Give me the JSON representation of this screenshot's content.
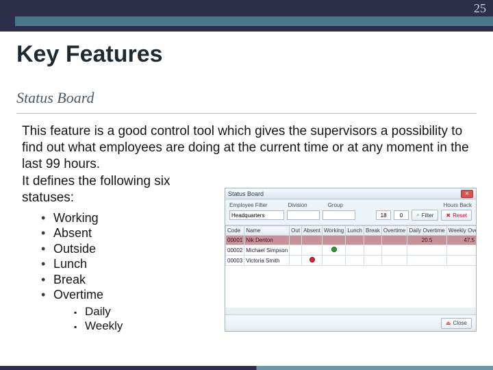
{
  "page_number": "25",
  "heading": "Key Features",
  "subheading": "Status Board",
  "paragraph1": "This feature is a good control tool which gives the supervisors a possibility to find out what employees are doing at the current time or at any moment in the last 99 hours.",
  "paragraph2": "It defines the following six statuses:",
  "statuses": [
    "Working",
    "Absent",
    "Outside",
    "Lunch",
    "Break",
    "Overtime"
  ],
  "overtime_sub": [
    "Daily",
    "Weekly"
  ],
  "shot": {
    "title": "Status Board",
    "filter_labels": {
      "employee": "Employee Filter",
      "division": "Division",
      "group": "Group",
      "hours_back": "Hours Back"
    },
    "filter_values": {
      "employee": "Headquarters",
      "division": "",
      "group": "",
      "hours_back_from": "18",
      "hours_back_to": "0"
    },
    "buttons": {
      "filter": "Filter",
      "reset": "Reset",
      "close": "Close"
    },
    "columns": [
      "Code",
      "Name",
      "Out",
      "Absent",
      "Working",
      "Lunch",
      "Break",
      "Overtime",
      "Daily Overtime",
      "Weekly Overtime"
    ],
    "rows": [
      {
        "code": "00001",
        "name": "Nik Denton",
        "out": "",
        "absent": "",
        "working": "",
        "lunch": "",
        "break": "",
        "overtime": "",
        "daily": "20.5",
        "weekly": "47.5",
        "selected": true
      },
      {
        "code": "00002",
        "name": "Michael Simpson",
        "out": "",
        "absent": "",
        "working": "green",
        "lunch": "",
        "break": "",
        "overtime": "",
        "daily": "",
        "weekly": ""
      },
      {
        "code": "00003",
        "name": "Victoria Smith",
        "out": "",
        "absent": "red",
        "working": "",
        "lunch": "",
        "break": "",
        "overtime": "",
        "daily": "",
        "weekly": ""
      }
    ]
  }
}
